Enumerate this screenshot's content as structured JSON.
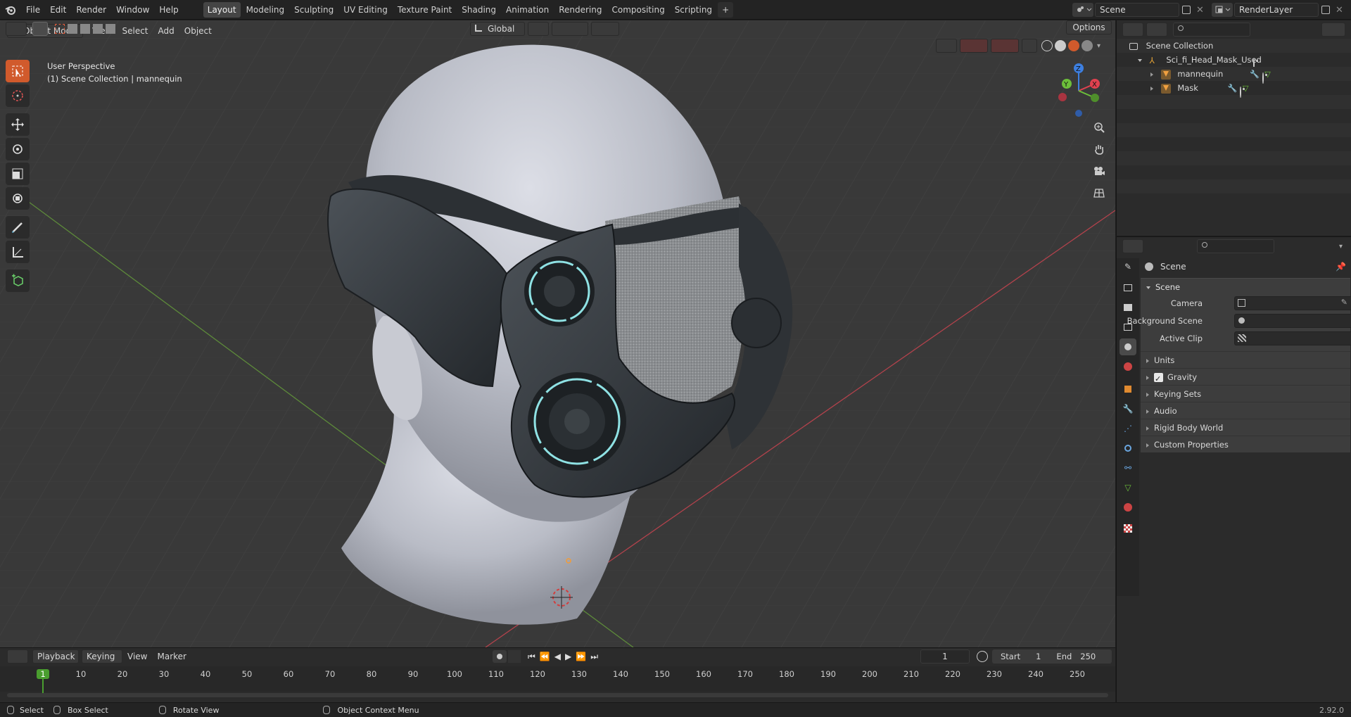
{
  "topbar": {
    "menu": [
      "File",
      "Edit",
      "Render",
      "Window",
      "Help"
    ],
    "workspaces": [
      "Layout",
      "Modeling",
      "Sculpting",
      "UV Editing",
      "Texture Paint",
      "Shading",
      "Animation",
      "Rendering",
      "Compositing",
      "Scripting"
    ],
    "active_workspace": "Layout",
    "add_label": "+",
    "scene_name": "Scene",
    "view_layer": "RenderLayer"
  },
  "viewport": {
    "mode": "Object Mode",
    "menu": [
      "View",
      "Select",
      "Add",
      "Object"
    ],
    "orientation": "Global",
    "options_label": "Options",
    "overlay_title": "User Perspective",
    "overlay_sub": "(1) Scene Collection | mannequin",
    "gizmo": {
      "x": "X",
      "y": "Y",
      "z": "Z"
    }
  },
  "timeline": {
    "menu": [
      "Playback",
      "Keying",
      "View",
      "Marker"
    ],
    "current_frame": "1",
    "start_label": "Start",
    "start_value": "1",
    "end_label": "End",
    "end_value": "250",
    "ticks": [
      "1",
      "10",
      "20",
      "30",
      "40",
      "50",
      "60",
      "70",
      "80",
      "90",
      "100",
      "110",
      "120",
      "130",
      "140",
      "150",
      "160",
      "170",
      "180",
      "190",
      "200",
      "210",
      "220",
      "230",
      "240",
      "250"
    ]
  },
  "statusbar": {
    "select": "Select",
    "box_select": "Box Select",
    "rotate_view": "Rotate View",
    "context_menu": "Object Context Menu",
    "version": "2.92.0"
  },
  "outliner": {
    "root": "Scene Collection",
    "collection": "Sci_fi_Head_Mask_Used",
    "objects": [
      "mannequin",
      "Mask"
    ]
  },
  "properties": {
    "header_title": "Scene",
    "scene_panel": "Scene",
    "camera_label": "Camera",
    "background_scene_label": "Background Scene",
    "active_clip_label": "Active Clip",
    "subpanels": {
      "units": "Units",
      "gravity": "Gravity",
      "keying_sets": "Keying Sets",
      "audio": "Audio",
      "rigid_body_world": "Rigid Body World",
      "custom_properties": "Custom Properties"
    },
    "gravity_enabled": true
  },
  "colors": {
    "accent": "#d15a2c",
    "active_tab": "#454545",
    "axis_x": "#e0414f",
    "axis_y": "#6cbf3a",
    "axis_z": "#3d7fe0",
    "frame_marker": "#4a9e2f"
  }
}
